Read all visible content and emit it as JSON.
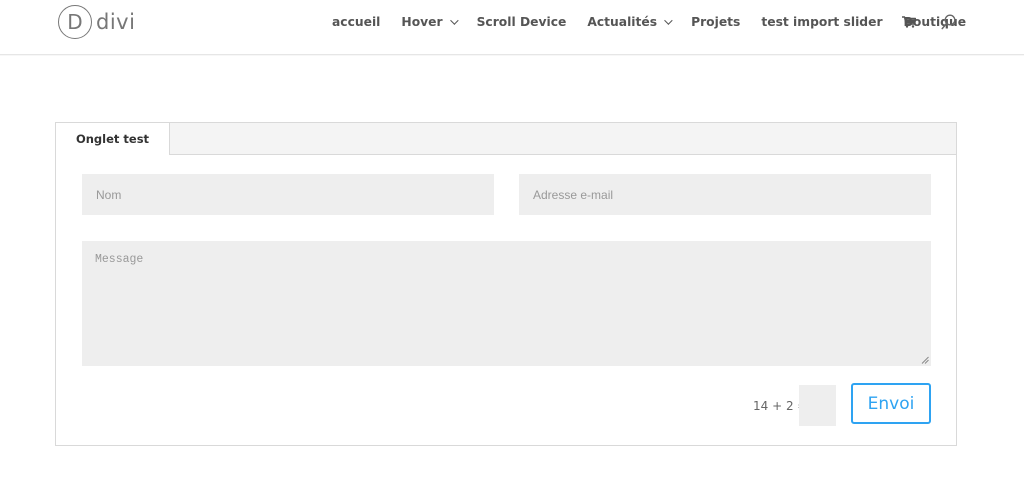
{
  "logo": {
    "mark": "D",
    "word": "divi"
  },
  "nav": {
    "items": [
      {
        "label": "accueil",
        "has_dropdown": false
      },
      {
        "label": "Hover",
        "has_dropdown": true
      },
      {
        "label": "Scroll Device",
        "has_dropdown": false
      },
      {
        "label": "Actualités",
        "has_dropdown": true
      },
      {
        "label": "Projets",
        "has_dropdown": false
      },
      {
        "label": "test import slider",
        "has_dropdown": false
      },
      {
        "label": "Boutique",
        "has_dropdown": false
      }
    ],
    "cart_icon": "cart-icon",
    "search_icon": "search-icon"
  },
  "tabs": {
    "active_tab": "Onglet test"
  },
  "form": {
    "name_placeholder": "Nom",
    "email_placeholder": "Adresse e-mail",
    "message_placeholder": "Message",
    "captcha_label": "14 + 2 =",
    "captcha_value": "",
    "submit_label": "Envoi"
  },
  "colors": {
    "accent": "#2ea3f2",
    "field_bg": "#eeeeee",
    "tab_bar_bg": "#f4f4f4",
    "border": "#d9d9d9"
  }
}
